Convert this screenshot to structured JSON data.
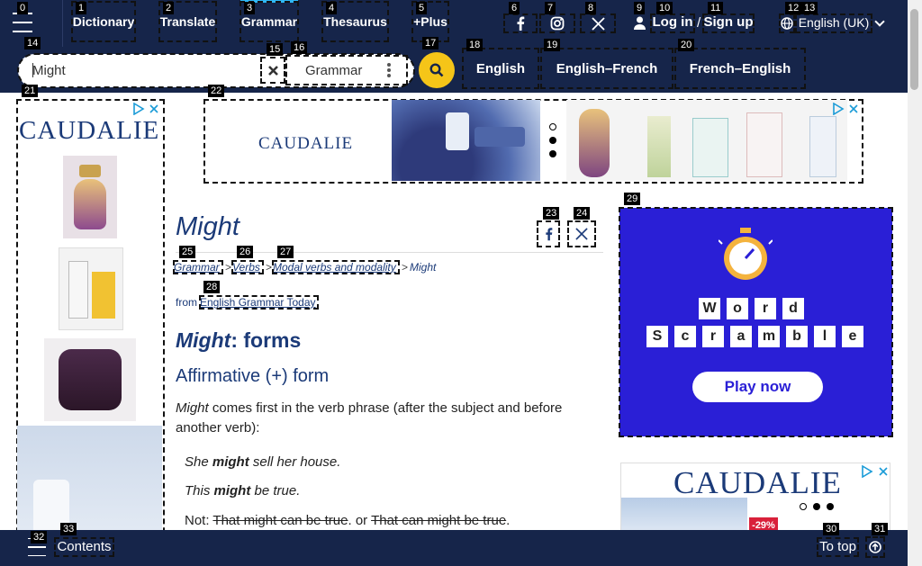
{
  "marks": [
    "0",
    "1",
    "2",
    "3",
    "4",
    "5",
    "6",
    "7",
    "8",
    "9",
    "10",
    "11",
    "12",
    "13",
    "14",
    "15",
    "16",
    "17",
    "18",
    "19",
    "20",
    "21",
    "22",
    "23",
    "24",
    "25",
    "26",
    "27",
    "28",
    "29",
    "30",
    "31",
    "32",
    "33"
  ],
  "nav": {
    "dictionary": "Dictionary",
    "translate": "Translate",
    "grammar": "Grammar",
    "thesaurus": "Thesaurus",
    "plus": "+Plus",
    "login": "Log in",
    "slash": "/",
    "signup": "Sign up",
    "language": "English (UK)"
  },
  "search": {
    "value": "Might",
    "dictionary_selector": "Grammar",
    "tabs": [
      "English",
      "English–French",
      "French–English"
    ]
  },
  "ads": {
    "brand": "CAUDALIE",
    "discount": "-29%",
    "word_scramble_row1": [
      "W",
      "o",
      "r",
      "d"
    ],
    "word_scramble_row2": [
      "S",
      "c",
      "r",
      "a",
      "m",
      "b",
      "l",
      "e"
    ],
    "play_now": "Play now"
  },
  "article": {
    "title": "Might",
    "breadcrumb": [
      "Grammar",
      "Verbs",
      "Modal verbs and modality",
      "Might"
    ],
    "breadcrumb_sep": ">",
    "from_label": "from",
    "source": "English Grammar Today",
    "heading_word": "Might",
    "heading_rest": ": forms",
    "subheading": "Affirmative (+) form",
    "intro_word": "Might",
    "intro_rest": " comes first in the verb phrase (after the subject and before another verb):",
    "ex1_pre": "She ",
    "ex1_bold": "might",
    "ex1_post": " sell her house.",
    "ex2_pre": "This ",
    "ex2_bold": "might",
    "ex2_post": " be true.",
    "ex3_label": "Not: ",
    "ex3_wrong1": "That might can be true",
    "ex3_mid": ". or ",
    "ex3_wrong2": "That can might be true",
    "ex3_end": "."
  },
  "footer": {
    "contents": "Contents",
    "to_top": "To top"
  },
  "colors": {
    "navy": "#16254a",
    "accent_blue": "#2fb7f5",
    "search_yellow": "#f5c518",
    "link_blue": "#1b3a78"
  }
}
